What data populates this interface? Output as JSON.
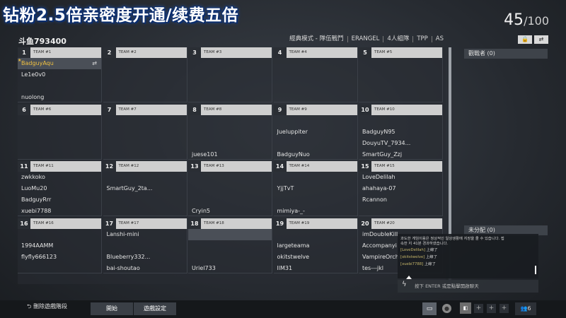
{
  "overlay_title": "钻粉2.5倍亲密度开通/续费五倍",
  "player_count": {
    "current": "45",
    "total": "/100"
  },
  "room_name": "斗鱼793400",
  "mode_bar": [
    "經典模式 - 隊伍戰鬥",
    "ERANGEL",
    "4人組隊",
    "TPP",
    "AS"
  ],
  "icons": {
    "lock": "lock-icon",
    "swap": "swap-icon"
  },
  "teams": [
    {
      "num": "1",
      "label": "TEAM #1",
      "slots": [
        "BadguyAqu",
        "Le1e0v0",
        "",
        "nuolong"
      ]
    },
    {
      "num": "2",
      "label": "TEAM #2",
      "slots": [
        "",
        "",
        "",
        ""
      ]
    },
    {
      "num": "3",
      "label": "TEAM #3",
      "slots": [
        "",
        "",
        "",
        ""
      ]
    },
    {
      "num": "4",
      "label": "TEAM #4",
      "slots": [
        "",
        "",
        "",
        ""
      ]
    },
    {
      "num": "5",
      "label": "TEAM #5",
      "slots": [
        "",
        "",
        "",
        ""
      ]
    },
    {
      "num": "6",
      "label": "TEAM #6",
      "slots": [
        "",
        "",
        "",
        ""
      ]
    },
    {
      "num": "7",
      "label": "TEAM #7",
      "slots": [
        "",
        "",
        "",
        ""
      ]
    },
    {
      "num": "8",
      "label": "TEAM #8",
      "slots": [
        "",
        "",
        "",
        "juese101"
      ]
    },
    {
      "num": "9",
      "label": "TEAM #9",
      "slots": [
        "",
        "Jueluppiter",
        "",
        "BadguyNuo"
      ]
    },
    {
      "num": "10",
      "label": "TEAM #10",
      "slots": [
        "",
        "BadguyN95",
        "DouyuTV_7934...",
        "SmartGuy_Zzj"
      ]
    },
    {
      "num": "11",
      "label": "TEAM #11",
      "slots": [
        "zwkkoko",
        "LuoMu20",
        "BadguyRrr",
        "xuebi7788"
      ]
    },
    {
      "num": "12",
      "label": "TEAM #12",
      "slots": [
        "",
        "SmartGuy_2ta...",
        "",
        ""
      ]
    },
    {
      "num": "13",
      "label": "TEAM #13",
      "slots": [
        "",
        "",
        "",
        "Cryin5"
      ]
    },
    {
      "num": "14",
      "label": "TEAM #14",
      "slots": [
        "",
        "YjjTvT",
        "",
        "mimiya-_-"
      ]
    },
    {
      "num": "15",
      "label": "TEAM #15",
      "slots": [
        "LoveDelilah",
        "ahahaya-07",
        "Rcannon",
        ""
      ]
    },
    {
      "num": "16",
      "label": "TEAM #16",
      "slots": [
        "",
        "1994AAMM",
        "flyfly666123",
        ""
      ]
    },
    {
      "num": "17",
      "label": "TEAM #17",
      "slots": [
        "Lanshi-mini",
        "",
        "Blueberry332...",
        "bai-shoutao"
      ]
    },
    {
      "num": "18",
      "label": "TEAM #18",
      "slots": [
        "",
        "",
        "",
        "Uriel733"
      ]
    },
    {
      "num": "19",
      "label": "TEAM #19",
      "slots": [
        "",
        "largeteama",
        "okitstwelve",
        "llM31"
      ]
    },
    {
      "num": "20",
      "label": "TEAM #20",
      "slots": [
        "imDoubleKill",
        "Accompanyi",
        "VampireOrchi...",
        "tes---jkl"
      ]
    }
  ],
  "observers_label": "觀戰者 (0)",
  "unassigned_label": "未分配 (0)",
  "chat": {
    "notice_line1": "과도한 게임이용은 정상적인 일상생활에 지장을 줄 수 있습니다. 접",
    "notice_line2": "속한 지 41분 경과하였습니다.",
    "lines": [
      {
        "who": "[LoveDelilah]",
        "msg": " 上線了"
      },
      {
        "who": "[okitstwelve]",
        "msg": " 上線了"
      },
      {
        "who": "[xuebi7788]",
        "msg": " 上線了"
      }
    ],
    "input_placeholder": "按下 ENTER 或是點擊開啟聊天"
  },
  "bottom": {
    "leave_label": "⮌ 刪除遊戲階段",
    "start_label": "開始",
    "settings_label": "遊戲設定",
    "friends_label": "6"
  }
}
